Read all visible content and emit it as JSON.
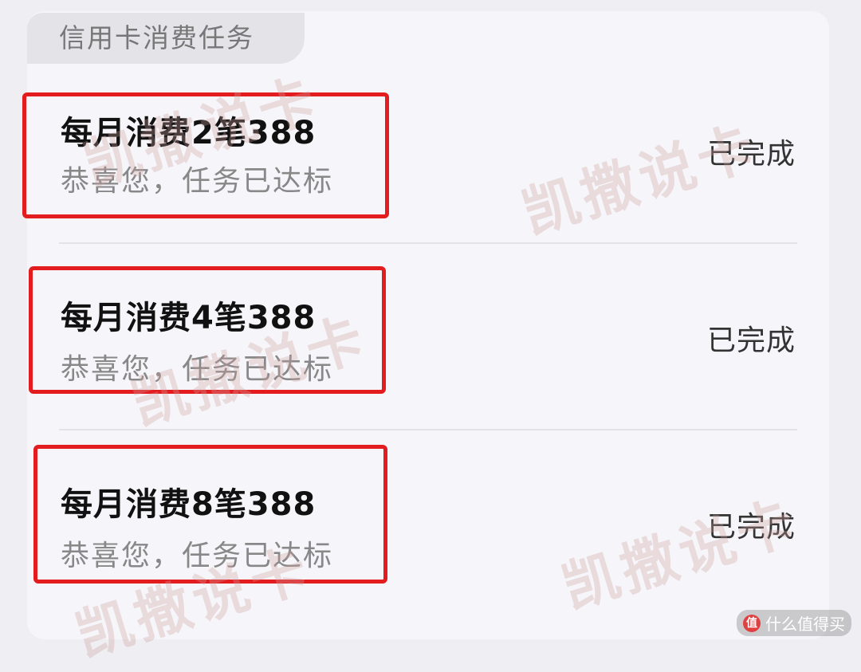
{
  "section": {
    "title": "信用卡消费任务"
  },
  "tasks": [
    {
      "title": "每月消费2笔388",
      "subtitle": "恭喜您，任务已达标",
      "status": "已完成"
    },
    {
      "title": "每月消费4笔388",
      "subtitle": "恭喜您，任务已达标",
      "status": "已完成"
    },
    {
      "title": "每月消费8笔388",
      "subtitle": "恭喜您，任务已达标",
      "status": "已完成"
    }
  ],
  "watermark_text": "凯撒说卡",
  "brand": {
    "label": "什么值得买",
    "icon_glyph": "值"
  },
  "colors": {
    "highlight": "#e31d1f",
    "card_bg": "#f6f6fa",
    "page_bg": "#eeeef3"
  }
}
